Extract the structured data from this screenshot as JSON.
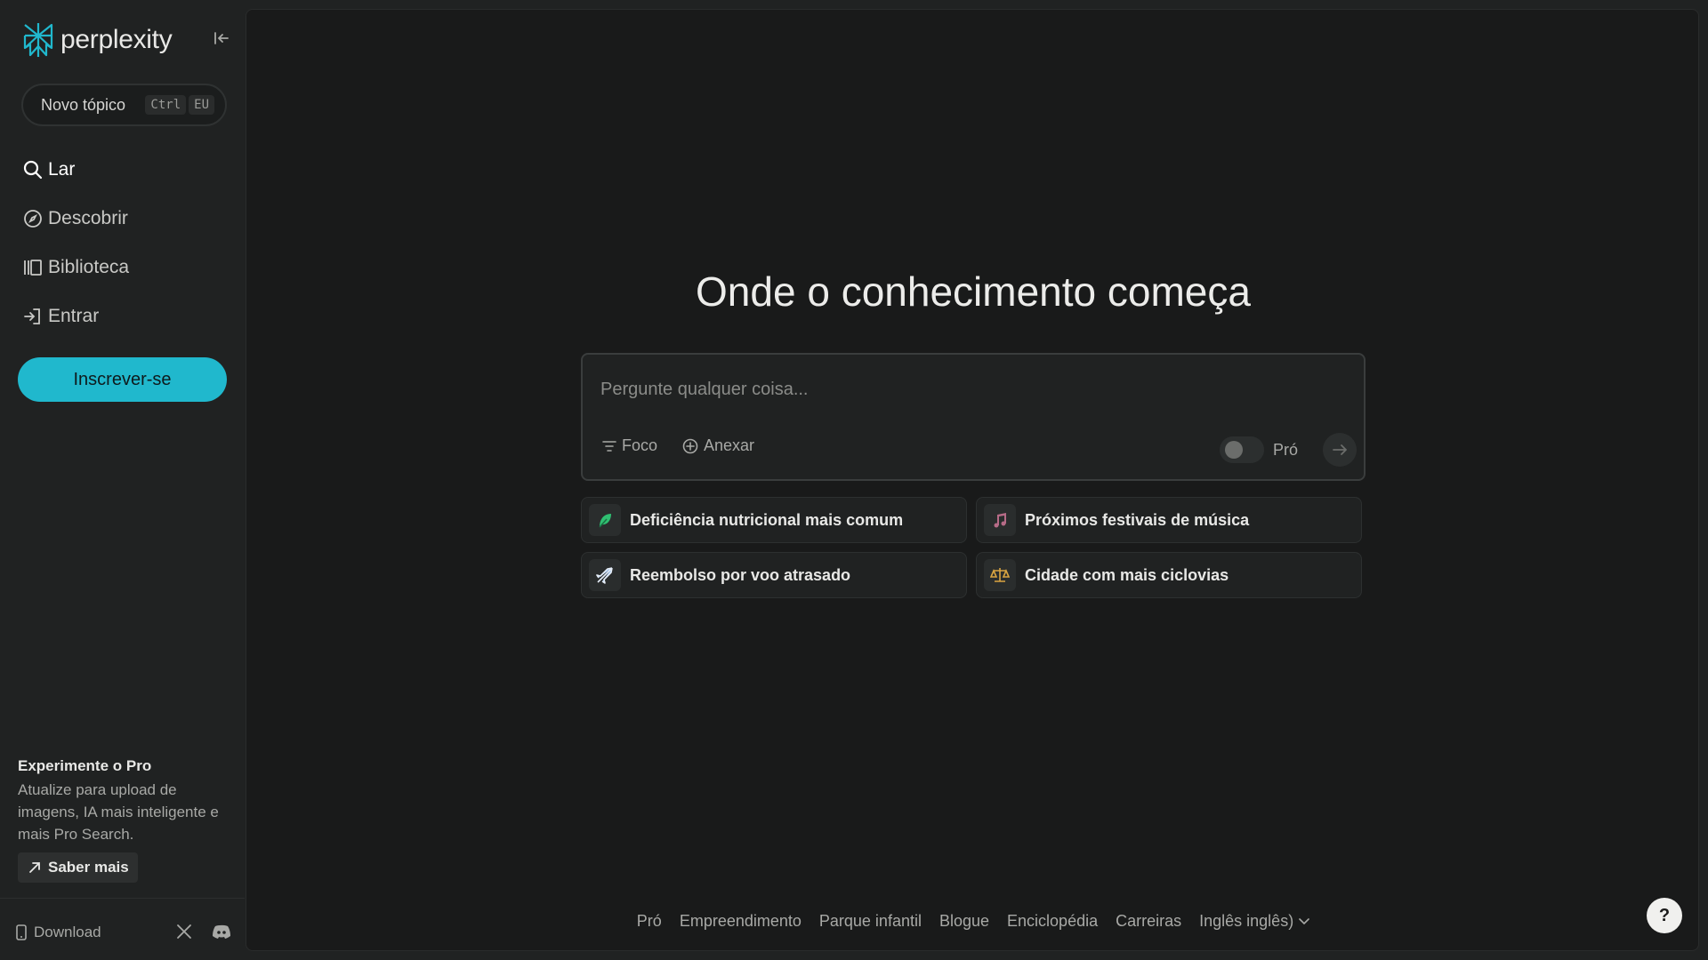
{
  "sidebar": {
    "logo_text": "perplexity",
    "new_topic": {
      "label": "Novo tópico",
      "kbd": [
        "Ctrl",
        "EU"
      ]
    },
    "nav": [
      {
        "label": "Lar",
        "icon": "search-icon"
      },
      {
        "label": "Descobrir",
        "icon": "compass-icon"
      },
      {
        "label": "Biblioteca",
        "icon": "library-icon"
      },
      {
        "label": "Entrar",
        "icon": "login-icon"
      }
    ],
    "signup_label": "Inscrever-se",
    "pro": {
      "title": "Experimente o Pro",
      "description": "Atualize para upload de imagens, IA mais inteligente e mais Pro Search.",
      "learn_more": "Saber mais"
    },
    "footer": {
      "download_label": "Download"
    }
  },
  "main": {
    "headline": "Onde o conhecimento começa",
    "search": {
      "placeholder": "Pergunte qualquer coisa...",
      "focus_label": "Foco",
      "attach_label": "Anexar",
      "pro_label": "Pró"
    },
    "suggestions": [
      {
        "text": "Deficiência nutricional mais comum",
        "icon": "leaf-icon"
      },
      {
        "text": "Próximos festivais de música",
        "icon": "music-note-icon"
      },
      {
        "text": "Reembolso por voo atrasado",
        "icon": "airplane-icon"
      },
      {
        "text": "Cidade com mais ciclovias",
        "icon": "scales-icon"
      }
    ],
    "footer_links": [
      "Pró",
      "Empreendimento",
      "Parque infantil",
      "Blogue",
      "Enciclopédia",
      "Carreiras",
      "Inglês inglês)"
    ],
    "help_label": "?"
  },
  "colors": {
    "accent": "#20b8cd",
    "background": "#191a1a",
    "sidebar": "#202222"
  }
}
